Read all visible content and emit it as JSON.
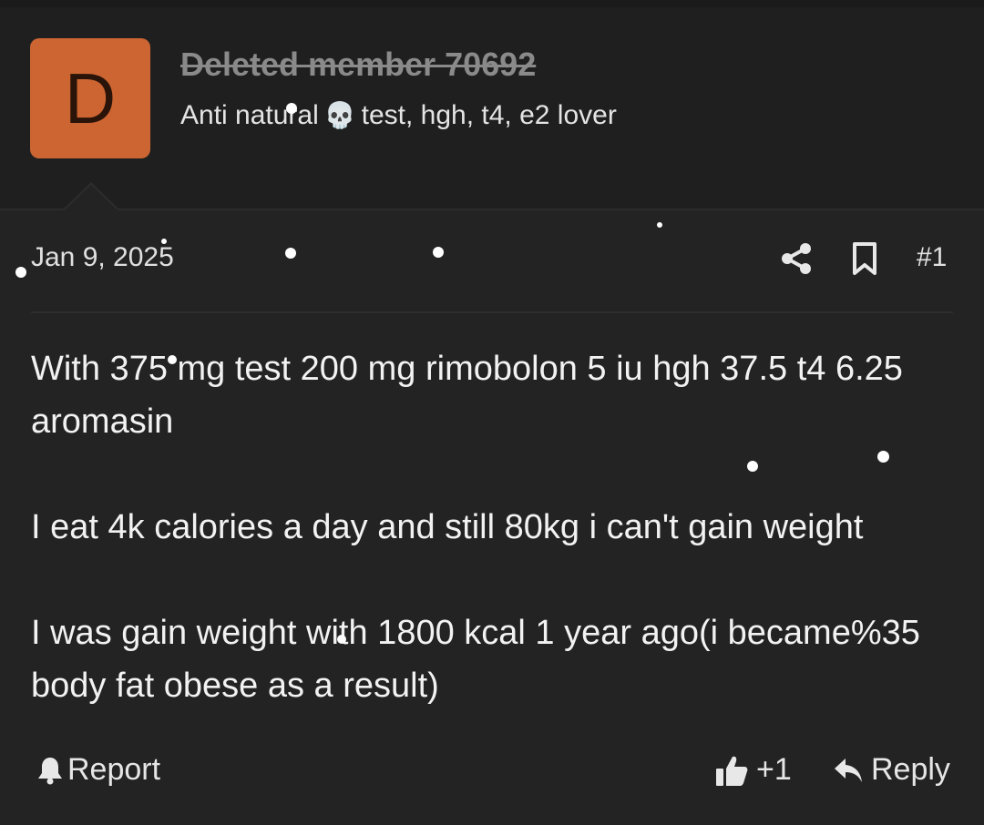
{
  "user": {
    "avatar_letter": "D",
    "avatar_color": "#cc6532",
    "username": "Deleted member 70692",
    "title_before_icon": "Anti natural",
    "title_icon": "skull-icon",
    "title_after_icon": "test, hgh, t4, e2 lover"
  },
  "post": {
    "date": "Jan 9, 2025",
    "number": "#1",
    "paragraphs": [
      "With 375 mg test 200 mg rimobolon 5 iu hgh 37.5 t4 6.25 aromasin",
      "I eat 4k calories a day and still 80kg i can't gain weight",
      "I was gain weight with 1800 kcal 1 year ago(i became%35 body fat obese as a result)"
    ]
  },
  "actions": {
    "report_label": "Report",
    "like_count": "+1",
    "reply_label": "Reply"
  },
  "icons": {
    "share": "share-icon",
    "bookmark": "bookmark-icon",
    "report": "bell-icon",
    "like": "thumbs-up-icon",
    "reply": "reply-arrow-icon"
  }
}
